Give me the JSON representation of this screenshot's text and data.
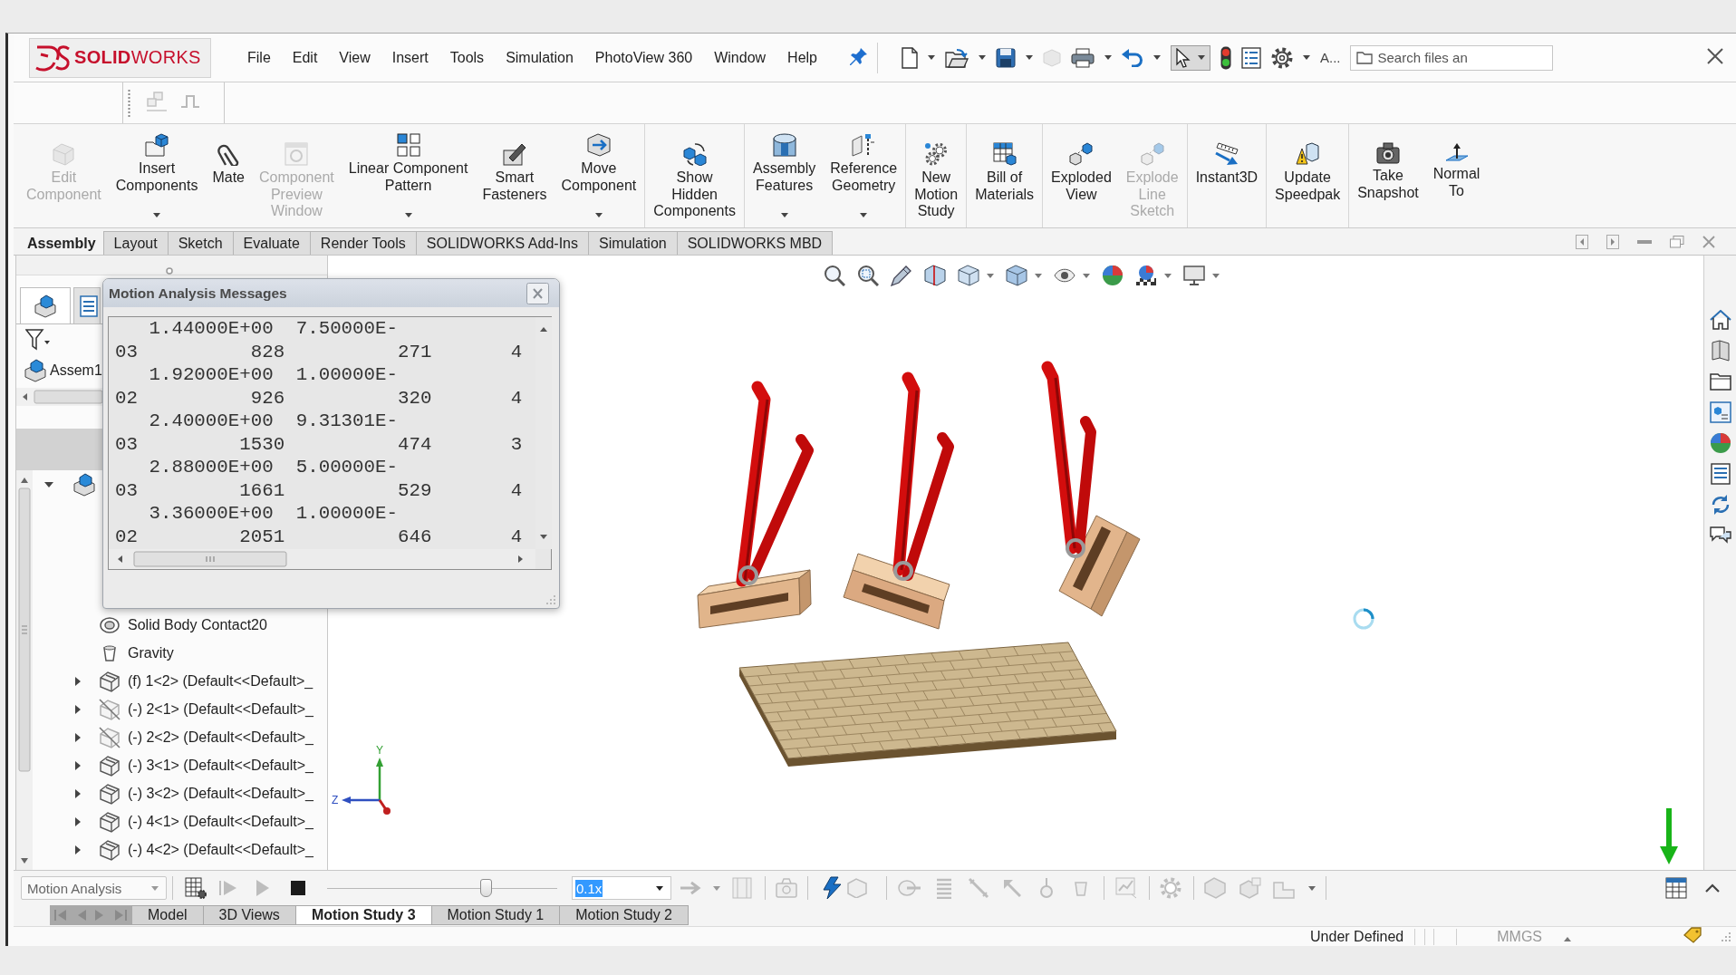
{
  "title_bar": {
    "logo": "**SOLID**WORKS",
    "menu": [
      "File",
      "Edit",
      "View",
      "Insert",
      "Tools",
      "Simulation",
      "PhotoView 360",
      "Window",
      "Help"
    ],
    "quick_access": {
      "select_active": true,
      "overflow": "A...",
      "search": {
        "placeholder": "Search files an"
      }
    }
  },
  "command_manager": {
    "groups": [
      {
        "buttons": [
          {
            "label": "Edit\nComponent",
            "disabled": true,
            "dropdown": false
          },
          {
            "label": "Insert\nComponents",
            "disabled": false,
            "dropdown": true
          },
          {
            "label": "Mate",
            "disabled": false,
            "dropdown": false
          },
          {
            "label": "Component\nPreview\nWindow",
            "disabled": true,
            "dropdown": false
          },
          {
            "label": "Linear Component\nPattern",
            "disabled": false,
            "dropdown": true
          },
          {
            "label": "Smart\nFasteners",
            "disabled": false,
            "dropdown": false
          },
          {
            "label": "Move\nComponent",
            "disabled": false,
            "dropdown": true
          }
        ]
      },
      {
        "buttons": [
          {
            "label": "Show\nHidden\nComponents",
            "disabled": false,
            "dropdown": false
          }
        ]
      },
      {
        "buttons": [
          {
            "label": "Assembly\nFeatures",
            "disabled": false,
            "dropdown": true
          },
          {
            "label": "Reference\nGeometry",
            "disabled": false,
            "dropdown": true
          }
        ]
      },
      {
        "buttons": [
          {
            "label": "New\nMotion\nStudy",
            "disabled": false,
            "dropdown": false
          }
        ]
      },
      {
        "buttons": [
          {
            "label": "Bill of\nMaterials",
            "disabled": false,
            "dropdown": false
          }
        ]
      },
      {
        "buttons": [
          {
            "label": "Exploded\nView",
            "disabled": false,
            "dropdown": false
          },
          {
            "label": "Explode\nLine\nSketch",
            "disabled": true,
            "dropdown": false
          }
        ]
      },
      {
        "buttons": [
          {
            "label": "Instant3D",
            "disabled": false,
            "dropdown": false
          }
        ]
      },
      {
        "buttons": [
          {
            "label": "Update\nSpeedpak",
            "disabled": false,
            "dropdown": false
          }
        ]
      },
      {
        "buttons": [
          {
            "label": "Take\nSnapshot",
            "disabled": false,
            "dropdown": false
          },
          {
            "label": "Normal\nTo",
            "disabled": false,
            "dropdown": false
          }
        ]
      }
    ]
  },
  "command_tabs": [
    {
      "label": "Assembly",
      "selected": true
    },
    {
      "label": "Layout",
      "selected": false
    },
    {
      "label": "Sketch",
      "selected": false
    },
    {
      "label": "Evaluate",
      "selected": false
    },
    {
      "label": "Render Tools",
      "selected": false
    },
    {
      "label": "SOLIDWORKS Add-Ins",
      "selected": false
    },
    {
      "label": "Simulation",
      "selected": false
    },
    {
      "label": "SOLIDWORKS MBD",
      "selected": false
    }
  ],
  "feature_manager": {
    "panel_tabs": [
      {
        "selected": true
      },
      {
        "selected": false
      }
    ],
    "root": "Assem1",
    "tree": {
      "expanded": true,
      "children": [
        {
          "kind": "contact",
          "label": "Solid Body Contact20"
        },
        {
          "kind": "gravity",
          "label": "Gravity"
        },
        {
          "kind": "part",
          "label": "(f) 1<2> (Default<<Default>_",
          "expanded": false,
          "suppressed": false
        },
        {
          "kind": "part",
          "label": "(-) 2<1> (Default<<Default>_",
          "expanded": false,
          "suppressed": true
        },
        {
          "kind": "part",
          "label": "(-) 2<2> (Default<<Default>_",
          "expanded": false,
          "suppressed": true
        },
        {
          "kind": "part",
          "label": "(-) 3<1> (Default<<Default>_",
          "expanded": false,
          "suppressed": false
        },
        {
          "kind": "part",
          "label": "(-) 3<2> (Default<<Default>_",
          "expanded": false,
          "suppressed": false
        },
        {
          "kind": "part",
          "label": "(-) 4<1> (Default<<Default>_",
          "expanded": false,
          "suppressed": false
        },
        {
          "kind": "part",
          "label": "(-) 4<2> (Default<<Default>_",
          "expanded": false,
          "suppressed": false
        }
      ]
    }
  },
  "graphics": {
    "triad": {
      "y_label": "Y",
      "z_label": "Z"
    }
  },
  "messages_dialog": {
    "title": "Motion Analysis Messages",
    "rows": [
      {
        "upper": [
          "1.44000E+00",
          "7.50000E-"
        ],
        "lower": [
          "03",
          "828",
          "271",
          "4"
        ]
      },
      {
        "upper": [
          "1.92000E+00",
          "1.00000E-"
        ],
        "lower": [
          "02",
          "926",
          "320",
          "4"
        ]
      },
      {
        "upper": [
          "2.40000E+00",
          "9.31301E-"
        ],
        "lower": [
          "03",
          "1530",
          "474",
          "3"
        ]
      },
      {
        "upper": [
          "2.88000E+00",
          "5.00000E-"
        ],
        "lower": [
          "03",
          "1661",
          "529",
          "4"
        ]
      },
      {
        "upper": [
          "3.36000E+00",
          "1.00000E-"
        ],
        "lower": [
          "02",
          "2051",
          "646",
          "4"
        ]
      }
    ]
  },
  "motion_manager": {
    "study_type": "Motion Analysis",
    "timeline": {
      "level": 0.69
    },
    "playback_speed": {
      "value": "0.1x",
      "highlighted": true
    },
    "tabs": [
      {
        "label": "Model",
        "selected": false
      },
      {
        "label": "3D Views",
        "selected": false
      },
      {
        "label": "Motion Study 3",
        "selected": true
      },
      {
        "label": "Motion Study 1",
        "selected": false
      },
      {
        "label": "Motion Study 2",
        "selected": false
      }
    ]
  },
  "status_bar": {
    "state": "Under Defined",
    "units": "MMGS"
  }
}
